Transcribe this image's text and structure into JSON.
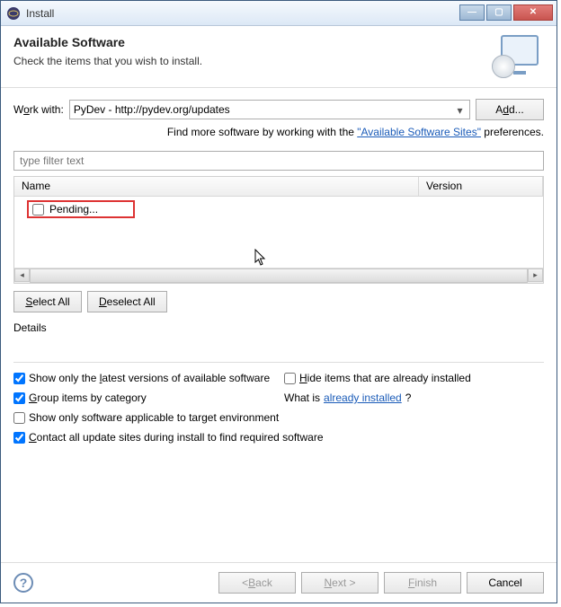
{
  "window": {
    "title": "Install"
  },
  "header": {
    "title": "Available Software",
    "subtitle": "Check the items that you wish to install."
  },
  "work_with": {
    "label_pre": "W",
    "label_u": "o",
    "label_post": "rk with:",
    "value": "PyDev - http://pydev.org/updates",
    "add_pre": "A",
    "add_u": "d",
    "add_post": "d..."
  },
  "find_more": {
    "pre": "Find more software by working with the ",
    "link": "\"Available Software Sites\"",
    "post": " preferences."
  },
  "filter": {
    "placeholder": "type filter text"
  },
  "tree": {
    "col_name": "Name",
    "col_version": "Version",
    "rows": [
      {
        "label": "Pending...",
        "checked": false
      }
    ]
  },
  "buttons": {
    "select_all_u": "S",
    "select_all_post": "elect All",
    "deselect_all_u": "D",
    "deselect_all_post": "eselect All"
  },
  "details": {
    "label": "Details"
  },
  "opts": {
    "latest_pre": "Show only the ",
    "latest_u": "l",
    "latest_post": "atest versions of available software",
    "hide_u": "H",
    "hide_post": "ide items that are already installed",
    "group_u": "G",
    "group_post": "roup items by category",
    "what_is": "What is ",
    "what_link": "already installed",
    "what_q": "?",
    "applicable": "Show only software applicable to target environment",
    "contact_u": "C",
    "contact_post": "ontact all update sites during install to find required software",
    "checked": {
      "latest": true,
      "hide": false,
      "group": true,
      "applicable": false,
      "contact": true
    }
  },
  "footer": {
    "back_lt": "< ",
    "back_u": "B",
    "back_post": "ack",
    "next_u": "N",
    "next_post": "ext >",
    "finish_u": "F",
    "finish_post": "inish",
    "cancel": "Cancel"
  }
}
